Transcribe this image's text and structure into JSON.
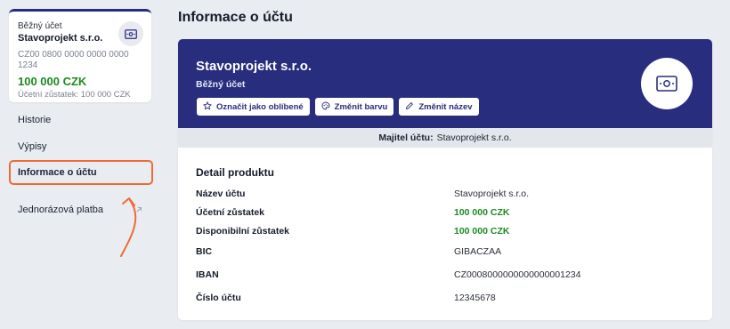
{
  "sidebar": {
    "card": {
      "type": "Běžný účet",
      "name": "Stavoprojekt s.r.o.",
      "account_number": "CZ00 0800 0000 0000 0000 1234",
      "balance": "100 000 CZK",
      "accounting_balance": "Účetní zůstatek: 100 000 CZK",
      "icon": "banknote-icon"
    },
    "nav": [
      {
        "label": "Historie"
      },
      {
        "label": "Výpisy"
      },
      {
        "label": "Informace o účtu"
      },
      {
        "label": "Jednorázová platba",
        "icon": "external-link-icon"
      }
    ],
    "active_index": 2
  },
  "main": {
    "title": "Informace o účtu",
    "hero": {
      "name": "Stavoprojekt s.r.o.",
      "type": "Běžný účet",
      "buttons": [
        {
          "label": "Označit jako oblíbené",
          "icon": "star-icon"
        },
        {
          "label": "Změnit barvu",
          "icon": "palette-icon"
        },
        {
          "label": "Změnit název",
          "icon": "pencil-icon"
        }
      ],
      "icon": "banknote-icon"
    },
    "owner": {
      "label": "Majitel účtu:",
      "value": "Stavoprojekt s.r.o."
    },
    "detail": {
      "title": "Detail produktu",
      "rows": [
        {
          "key": "Název účtu",
          "value": "Stavoprojekt s.r.o."
        },
        {
          "key": "Účetní zůstatek",
          "value": "100 000 CZK"
        },
        {
          "key": "Disponibilní zůstatek",
          "value": "100 000 CZK"
        },
        {
          "key": "BIC",
          "value": "GIBACZAA"
        },
        {
          "key": "IBAN",
          "value": "CZ0008000000000000001234"
        },
        {
          "key": "Číslo účtu",
          "value": "12345678"
        }
      ]
    }
  },
  "colors": {
    "brand": "#282d7d",
    "positive": "#1b8a1f",
    "highlight": "#f06a35",
    "background": "#e9ecf0"
  }
}
